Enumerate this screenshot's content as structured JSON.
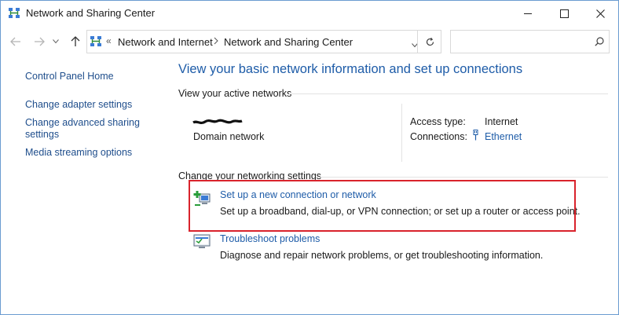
{
  "window": {
    "title": "Network and Sharing Center",
    "title_icon": "network-sharing-icon"
  },
  "nav": {
    "back_icon": "back-arrow-icon",
    "forward_icon": "forward-arrow-icon",
    "recent_icon": "chevron-down-icon",
    "up_icon": "up-arrow-icon",
    "breadcrumb": [
      "Network and Internet",
      "Network and Sharing Center"
    ],
    "overflow": "«",
    "search_placeholder": ""
  },
  "left_pane": {
    "home": "Control Panel Home",
    "items": [
      "Change adapter settings",
      "Change advanced sharing",
      "settings",
      "Media streaming options"
    ]
  },
  "main": {
    "heading": "View your basic network information and set up connections",
    "active_networks_label": "View your active networks",
    "network": {
      "name_redacted": "",
      "type": "Domain network",
      "access_type_label": "Access type:",
      "access_type_value": "Internet",
      "connections_label": "Connections:",
      "connections_value": "Ethernet"
    },
    "change_settings_label": "Change your networking settings",
    "tasks": [
      {
        "title": "Set up a new connection or network",
        "description": "Set up a broadband, dial-up, or VPN connection; or set up a router or access point.",
        "icon": "new-connection-icon"
      },
      {
        "title": "Troubleshoot problems",
        "description": "Diagnose and repair network problems, or get troubleshooting information.",
        "icon": "troubleshoot-icon"
      }
    ]
  },
  "colors": {
    "link": "#1e5ca8",
    "highlight_box": "#d9232c"
  }
}
